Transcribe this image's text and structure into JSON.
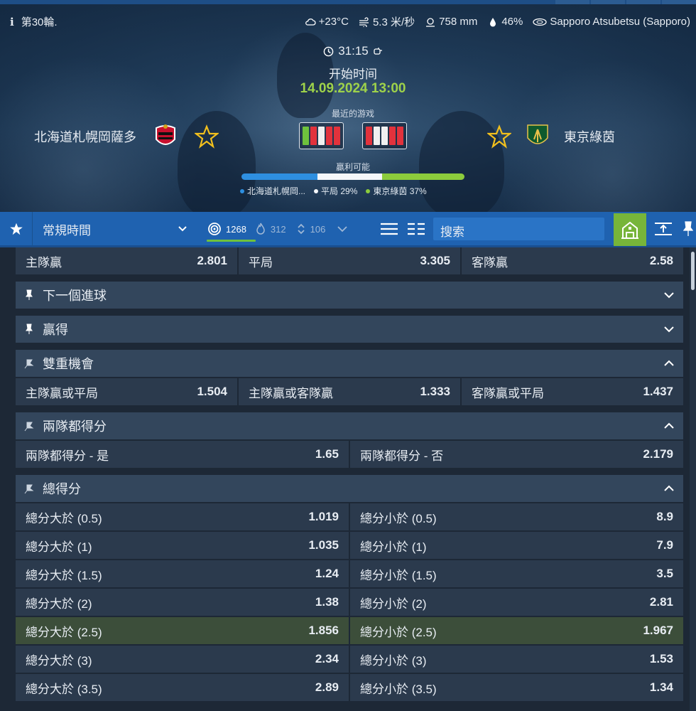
{
  "header": {
    "round": "第30輪.",
    "weather": {
      "temp": "+23°C",
      "wind": "5.3 米/秒",
      "pressure": "758 mm",
      "humidity": "46%"
    },
    "venue": "Sapporo Atsubetsu (Sapporo)"
  },
  "match": {
    "clock": "31:15",
    "start_label": "开始时间",
    "start_datetime": "14.09.2024 13:00",
    "recent_label": "最近的游戏",
    "win_label": "贏利可能",
    "home_team": "北海道札幌岡薩多",
    "away_team": "東京綠茵",
    "home_form": [
      "W",
      "L",
      "D",
      "L",
      "L"
    ],
    "away_form": [
      "L",
      "D",
      "D",
      "L",
      "L"
    ],
    "probabilities": {
      "home_label": "北海道札幌岡...",
      "draw_label": "平局 29%",
      "away_label": "東京綠茵 37%",
      "home_pct": 34,
      "draw_pct": 29,
      "away_pct": 37
    },
    "colors": {
      "home": "#2e8fe0",
      "draw": "#f5f7fa",
      "away": "#8ccc3c",
      "win": "#6ec23d",
      "loss": "#e2323c"
    }
  },
  "toolbar": {
    "period": "常規時間",
    "count_markets": "1268",
    "count_popular": "312",
    "count_sorted": "106",
    "search_placeholder": "搜索"
  },
  "markets": {
    "main": [
      {
        "label": "主隊贏",
        "value": "2.801"
      },
      {
        "label": "平局",
        "value": "3.305"
      },
      {
        "label": "客隊贏",
        "value": "2.58"
      }
    ],
    "next_goal": {
      "title": "下一個進球"
    },
    "win": {
      "title": "贏得"
    },
    "double_chance": {
      "title": "雙重機會",
      "items": [
        {
          "label": "主隊贏或平局",
          "value": "1.504"
        },
        {
          "label": "主隊贏或客隊贏",
          "value": "1.333"
        },
        {
          "label": "客隊贏或平局",
          "value": "1.437"
        }
      ]
    },
    "btts": {
      "title": "兩隊都得分",
      "items": [
        {
          "label": "兩隊都得分 - 是",
          "value": "1.65"
        },
        {
          "label": "兩隊都得分 - 否",
          "value": "2.179"
        }
      ]
    },
    "total": {
      "title": "總得分",
      "rows": [
        {
          "over": "總分大於 (0.5)",
          "over_v": "1.019",
          "under": "總分小於 (0.5)",
          "under_v": "8.9"
        },
        {
          "over": "總分大於 (1)",
          "over_v": "1.035",
          "under": "總分小於 (1)",
          "under_v": "7.9"
        },
        {
          "over": "總分大於 (1.5)",
          "over_v": "1.24",
          "under": "總分小於 (1.5)",
          "under_v": "3.5"
        },
        {
          "over": "總分大於 (2)",
          "over_v": "1.38",
          "under": "總分小於 (2)",
          "under_v": "2.81"
        },
        {
          "over": "總分大於 (2.5)",
          "over_v": "1.856",
          "under": "總分小於 (2.5)",
          "under_v": "1.967"
        },
        {
          "over": "總分大於 (3)",
          "over_v": "2.34",
          "under": "總分小於 (3)",
          "under_v": "1.53"
        },
        {
          "over": "總分大於 (3.5)",
          "over_v": "2.89",
          "under": "總分小於 (3.5)",
          "under_v": "1.34"
        }
      ]
    }
  }
}
